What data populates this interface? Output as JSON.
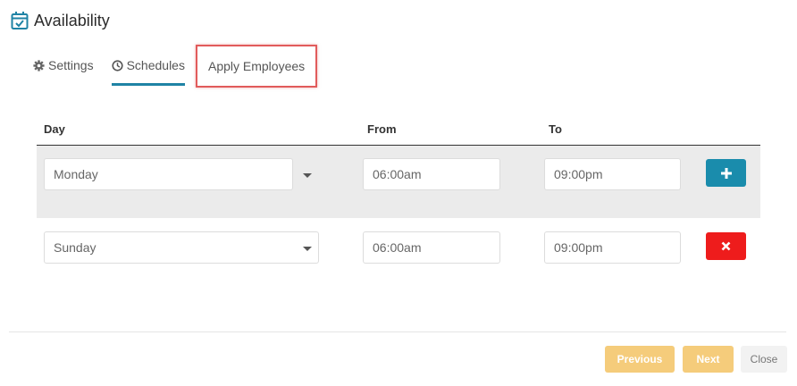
{
  "header": {
    "title": "Availability",
    "icon": "calendar-check-icon"
  },
  "tabs": [
    {
      "label": "Settings",
      "icon": "gear-icon"
    },
    {
      "label": "Schedules",
      "icon": "clock-icon",
      "active": true
    },
    {
      "label": "Apply Employees",
      "highlighted": true
    }
  ],
  "table": {
    "columns": {
      "day": "Day",
      "from": "From",
      "to": "To"
    },
    "rows": [
      {
        "day": "Monday",
        "from": "06:00am",
        "to": "09:00pm",
        "action": "add"
      },
      {
        "day": "Sunday",
        "from": "06:00am",
        "to": "09:00pm",
        "action": "remove"
      }
    ]
  },
  "footer": {
    "previous": "Previous",
    "next": "Next",
    "close": "Close"
  },
  "colors": {
    "accent": "#1a8cac",
    "danger": "#ee1c1c",
    "warning": "#f5cc7b",
    "highlight_box": "#e15b5b"
  }
}
